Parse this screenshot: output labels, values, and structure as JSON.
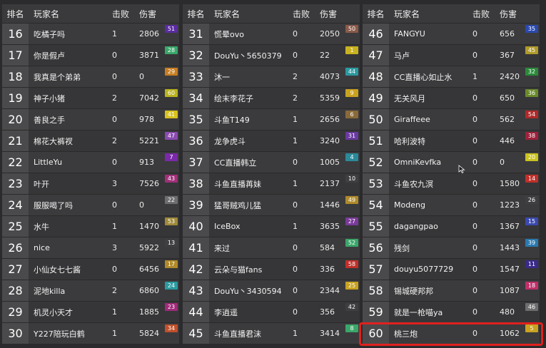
{
  "headers": {
    "rank": "排名",
    "name": "玩家名",
    "kills": "击败",
    "damage": "伤害"
  },
  "colors": {
    "highlight_frame": "#e0201e",
    "badge_purple": "#6a2c8f",
    "badge_green": "#3a9a5a",
    "badge_orange": "#c9901f",
    "badge_yellow": "#cfc01f",
    "badge_teal": "#2b9aa0",
    "badge_red": "#b02a2a",
    "badge_gray": "#6e6e70",
    "badge_brown": "#8a6a3a",
    "badge_blue": "#3a5fbf",
    "badge_darkgray": "#3f3f41"
  },
  "highlighted_rank": "60",
  "columns": [
    [
      {
        "rank": "16",
        "name": "吃橘子吗",
        "kills": "1",
        "damage": "2806",
        "badge": "51",
        "badge_color": "#5a2ca0"
      },
      {
        "rank": "17",
        "name": "你是假卢",
        "kills": "0",
        "damage": "3871",
        "badge": "28",
        "badge_color": "#3aa66a"
      },
      {
        "rank": "18",
        "name": "我真是个弟弟",
        "kills": "0",
        "damage": "0",
        "badge": "29",
        "badge_color": "#c77e22"
      },
      {
        "rank": "19",
        "name": "神子小猪",
        "kills": "2",
        "damage": "7042",
        "badge": "60",
        "badge_color": "#b9b21f"
      },
      {
        "rank": "20",
        "name": "善良之手",
        "kills": "0",
        "damage": "978",
        "badge": "41",
        "badge_color": "#d7c21f"
      },
      {
        "rank": "21",
        "name": "棉花大裤衩",
        "kills": "2",
        "damage": "5221",
        "badge": "47",
        "badge_color": "#8a4ab0"
      },
      {
        "rank": "22",
        "name": "LittleYu",
        "kills": "0",
        "damage": "913",
        "badge": "7",
        "badge_color": "#7a2aa8"
      },
      {
        "rank": "23",
        "name": "叶开",
        "kills": "3",
        "damage": "7526",
        "badge": "43",
        "badge_color": "#a0307a"
      },
      {
        "rank": "24",
        "name": "服服喝了吗",
        "kills": "0",
        "damage": "0",
        "badge": "22",
        "badge_color": "#6e6e70"
      },
      {
        "rank": "25",
        "name": "水牛",
        "kills": "1",
        "damage": "1470",
        "badge": "53",
        "badge_color": "#a08a3a"
      },
      {
        "rank": "26",
        "name": "nice",
        "kills": "3",
        "damage": "5922",
        "badge": "13",
        "badge_color": "#3f3f41"
      },
      {
        "rank": "27",
        "name": "小仙女七七酱",
        "kills": "0",
        "damage": "6456",
        "badge": "17",
        "badge_color": "#b08a2a"
      },
      {
        "rank": "28",
        "name": "泥地killa",
        "kills": "2",
        "damage": "6860",
        "badge": "24",
        "badge_color": "#2b9aa0"
      },
      {
        "rank": "29",
        "name": "机灵小天才",
        "kills": "1",
        "damage": "1885",
        "badge": "23",
        "badge_color": "#a02a7a"
      },
      {
        "rank": "30",
        "name": "Y227陪玩白鹤",
        "kills": "1",
        "damage": "5824",
        "badge": "34",
        "badge_color": "#c0502a"
      }
    ],
    [
      {
        "rank": "31",
        "name": "慌晕ovo",
        "kills": "0",
        "damage": "2050",
        "badge": "50",
        "badge_color": "#8a5a4a"
      },
      {
        "rank": "32",
        "name": "DouYu丶5650379",
        "kills": "0",
        "damage": "22",
        "badge": "1",
        "badge_color": "#c9b21f"
      },
      {
        "rank": "33",
        "name": "沐一",
        "kills": "2",
        "damage": "4073",
        "badge": "44",
        "badge_color": "#2b9aa0"
      },
      {
        "rank": "34",
        "name": "绘末李花子",
        "kills": "2",
        "damage": "5359",
        "badge": "9",
        "badge_color": "#c9a21f"
      },
      {
        "rank": "35",
        "name": "斗鱼T149",
        "kills": "1",
        "damage": "2656",
        "badge": "6",
        "badge_color": "#8a6a3a"
      },
      {
        "rank": "36",
        "name": "龙争虎斗",
        "kills": "1",
        "damage": "3240",
        "badge": "31",
        "badge_color": "#6a3aa0"
      },
      {
        "rank": "37",
        "name": "CC直播韩立",
        "kills": "0",
        "damage": "1005",
        "badge": "4",
        "badge_color": "#2b8a9a"
      },
      {
        "rank": "38",
        "name": "斗鱼直播苒妹",
        "kills": "1",
        "damage": "2137",
        "badge": "10",
        "badge_color": "#3f3f41"
      },
      {
        "rank": "39",
        "name": "猛哥贼鸡儿猛",
        "kills": "0",
        "damage": "1446",
        "badge": "49",
        "badge_color": "#b08a2a"
      },
      {
        "rank": "40",
        "name": "IceBox",
        "kills": "1",
        "damage": "3635",
        "badge": "27",
        "badge_color": "#7a3a9a"
      },
      {
        "rank": "41",
        "name": "来过",
        "kills": "0",
        "damage": "584",
        "badge": "52",
        "badge_color": "#3aa66a"
      },
      {
        "rank": "42",
        "name": "云朵与猫fans",
        "kills": "0",
        "damage": "336",
        "badge": "58",
        "badge_color": "#c0302a"
      },
      {
        "rank": "43",
        "name": "DouYu丶3430594",
        "kills": "0",
        "damage": "2344",
        "badge": "25",
        "badge_color": "#c9a21f"
      },
      {
        "rank": "44",
        "name": "李逍遥",
        "kills": "0",
        "damage": "356",
        "badge": "42",
        "badge_color": "#3f3f41"
      },
      {
        "rank": "45",
        "name": "斗鱼直播君沫",
        "kills": "1",
        "damage": "3414",
        "badge": "8",
        "badge_color": "#3aa66a"
      }
    ],
    [
      {
        "rank": "46",
        "name": "FANGYU",
        "kills": "0",
        "damage": "656",
        "badge": "35",
        "badge_color": "#2a4ab0"
      },
      {
        "rank": "47",
        "name": "马卢",
        "kills": "0",
        "damage": "367",
        "badge": "45",
        "badge_color": "#b09a2a"
      },
      {
        "rank": "48",
        "name": "CC直播心如止水",
        "kills": "1",
        "damage": "2420",
        "badge": "32",
        "badge_color": "#2a8a3a"
      },
      {
        "rank": "49",
        "name": "无关风月",
        "kills": "0",
        "damage": "650",
        "badge": "36",
        "badge_color": "#6a8a2a"
      },
      {
        "rank": "50",
        "name": "Giraffeee",
        "kills": "0",
        "damage": "562",
        "badge": "54",
        "badge_color": "#b02a2a"
      },
      {
        "rank": "51",
        "name": "哈利波特",
        "kills": "0",
        "damage": "446",
        "badge": "38",
        "badge_color": "#a0203a"
      },
      {
        "rank": "52",
        "name": "OmniKevfka",
        "kills": "0",
        "damage": "0",
        "badge": "20",
        "badge_color": "#c9c21f"
      },
      {
        "rank": "53",
        "name": "斗鱼农九溟",
        "kills": "0",
        "damage": "1580",
        "badge": "14",
        "badge_color": "#c0302a"
      },
      {
        "rank": "54",
        "name": "Modeng",
        "kills": "0",
        "damage": "1223",
        "badge": "26",
        "badge_color": "#3f3f41"
      },
      {
        "rank": "55",
        "name": "dagangpao",
        "kills": "0",
        "damage": "1367",
        "badge": "15",
        "badge_color": "#3a4ab0"
      },
      {
        "rank": "56",
        "name": "残剑",
        "kills": "0",
        "damage": "1443",
        "badge": "39",
        "badge_color": "#2a7ab0"
      },
      {
        "rank": "57",
        "name": "douyu5077729",
        "kills": "0",
        "damage": "1547",
        "badge": "11",
        "badge_color": "#3a2a8a"
      },
      {
        "rank": "58",
        "name": "锡城硬邦邦",
        "kills": "0",
        "damage": "1087",
        "badge": "18",
        "badge_color": "#c0306a"
      },
      {
        "rank": "59",
        "name": "就是一枪喵ya",
        "kills": "0",
        "damage": "480",
        "badge": "46",
        "badge_color": "#6e6e70"
      },
      {
        "rank": "60",
        "name": "桃三炮",
        "kills": "0",
        "damage": "1062",
        "badge": "5",
        "badge_color": "#c9a21f"
      }
    ]
  ]
}
